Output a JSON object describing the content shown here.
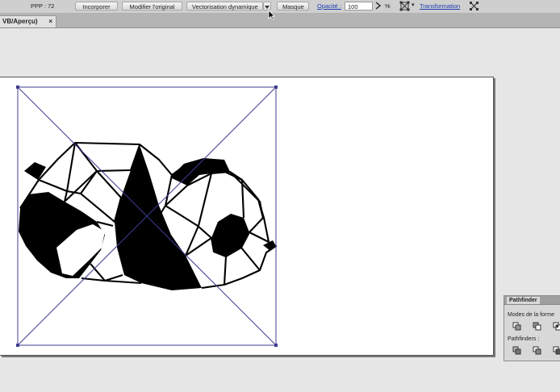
{
  "control_bar": {
    "ppp": "PPP : 72",
    "embed_label": "Incorporer",
    "edit_original_label": "Modifier l'original",
    "live_trace_label": "Vectorisation dynamique",
    "mask_label": "Masque",
    "opacity_label": "Opacité :",
    "opacity_value": "100",
    "percent": "%",
    "transform_label": "Transformation"
  },
  "document_tab": {
    "title": "VB/Aperçu)",
    "close": "×"
  },
  "pathfinder_panel": {
    "title": "Pathfinder",
    "shape_modes_label": "Modes de la forme",
    "pathfinders_label": "Pathfinders :"
  },
  "icons": [
    "dropdown-arrow-icon",
    "arrow-right-icon",
    "bounding-box-icon",
    "align-icon",
    "unite-icon",
    "minus-front-icon",
    "intersect-icon",
    "divide-icon",
    "trim-icon",
    "merge-icon"
  ],
  "colors": {
    "selection": "#3d3d8f",
    "artwork": "#000000",
    "link": "#1b3fb0"
  }
}
